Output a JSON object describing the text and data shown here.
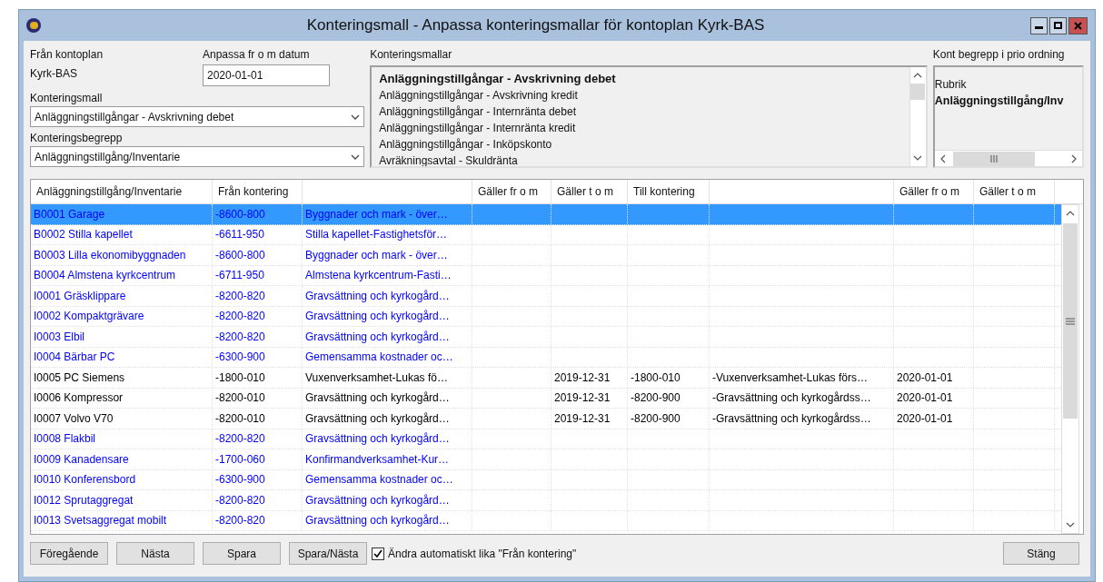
{
  "window": {
    "title": "Konteringsmall - Anpassa konteringsmallar för kontoplan Kyrk-BAS"
  },
  "source_plan": {
    "label": "Från kontoplan",
    "value": "Kyrk-BAS"
  },
  "date_field": {
    "label": "Anpassa fr o m datum",
    "value": "2020-01-01"
  },
  "template_select": {
    "label": "Konteringsmall",
    "value": "Anläggningstillgångar - Avskrivning debet"
  },
  "concept_select": {
    "label": "Konteringsbegrepp",
    "value": "Anläggningstillgång/Inventarie"
  },
  "templates": {
    "label": "Konteringsmallar",
    "items": [
      {
        "text": "Anläggningstillgångar - Avskrivning debet",
        "selected": true
      },
      {
        "text": "Anläggningstillgångar - Avskrivning kredit",
        "selected": false
      },
      {
        "text": "Anläggningstillgångar - Internränta debet",
        "selected": false
      },
      {
        "text": "Anläggningstillgångar - Internränta kredit",
        "selected": false
      },
      {
        "text": "Anläggningstillgångar - Inköpskonto",
        "selected": false
      },
      {
        "text": "Avräkningsavtal - Skuldränta",
        "selected": false
      }
    ]
  },
  "priority": {
    "label": "Kont begrepp i prio ordning",
    "items": [
      {
        "text": "Rubrik",
        "selected": false
      },
      {
        "text": "Anläggningstillgång/Inv",
        "selected": true
      }
    ]
  },
  "table": {
    "columns": [
      {
        "label": "Anläggningstillgång/Inventarie"
      },
      {
        "label": "Från kontering"
      },
      {},
      {
        "label": "Gäller fr o m"
      },
      {
        "label": "Gäller t o m"
      },
      {
        "label": "Till kontering"
      },
      {},
      {
        "label": "Gäller fr o m"
      },
      {
        "label": "Gäller t o m"
      }
    ],
    "rows": [
      {
        "selected": true,
        "color": "#0000ff",
        "asset": "B0001 Garage",
        "from_account": "-8600-800",
        "from_name": "Byggnader och mark - över…"
      },
      {
        "selected": false,
        "color": "#0000ff",
        "asset": "B0002 Stilla kapellet",
        "from_account": "-6611-950",
        "from_name": "Stilla kapellet-Fastighetsför…"
      },
      {
        "selected": false,
        "color": "#0000ff",
        "asset": "B0003 Lilla ekonomibyggnaden",
        "from_account": "-8600-800",
        "from_name": "Byggnader och mark - över…"
      },
      {
        "selected": false,
        "color": "#0000ff",
        "asset": "B0004 Almstena kyrkcentrum",
        "from_account": "-6711-950",
        "from_name": "Almstena kyrkcentrum-Fasti…"
      },
      {
        "selected": false,
        "color": "#0000ff",
        "asset": "I0001 Gräsklippare",
        "from_account": "-8200-820",
        "from_name": "Gravsättning och kyrkogård…"
      },
      {
        "selected": false,
        "color": "#0000ff",
        "asset": "I0002 Kompaktgrävare",
        "from_account": "-8200-820",
        "from_name": "Gravsättning och kyrkogård…"
      },
      {
        "selected": false,
        "color": "#0000ff",
        "asset": "I0003 Elbil",
        "from_account": "-8200-820",
        "from_name": "Gravsättning och kyrkogård…"
      },
      {
        "selected": false,
        "color": "#0000ff",
        "asset": "I0004 Bärbar PC",
        "from_account": "-6300-900",
        "from_name": "Gemensamma kostnader oc…"
      },
      {
        "selected": false,
        "color": "#000000",
        "asset": "I0005 PC Siemens",
        "from_account": "-1800-010",
        "from_name": "Vuxenverksamhet-Lukas fö…",
        "valid_to": "2019-12-31",
        "to_account": "-1800-010",
        "to_name": "-Vuxenverksamhet-Lukas förs…",
        "valid_from_2": "2020-01-01"
      },
      {
        "selected": false,
        "color": "#000000",
        "asset": "I0006 Kompressor",
        "from_account": "-8200-010",
        "from_name": "Gravsättning och kyrkogård…",
        "valid_to": "2019-12-31",
        "to_account": "-8200-900",
        "to_name": "-Gravsättning och kyrkogårdss…",
        "valid_from_2": "2020-01-01"
      },
      {
        "selected": false,
        "color": "#000000",
        "asset": "I0007 Volvo V70",
        "from_account": "-8200-010",
        "from_name": "Gravsättning och kyrkogård…",
        "valid_to": "2019-12-31",
        "to_account": "-8200-900",
        "to_name": "-Gravsättning och kyrkogårdss…",
        "valid_from_2": "2020-01-01"
      },
      {
        "selected": false,
        "color": "#0000ff",
        "asset": "I0008 Flakbil",
        "from_account": "-8200-820",
        "from_name": "Gravsättning och kyrkogård…"
      },
      {
        "selected": false,
        "color": "#0000ff",
        "asset": "I0009 Kanadensare",
        "from_account": "-1700-060",
        "from_name": "Konfirmandverksamhet-Kur…"
      },
      {
        "selected": false,
        "color": "#0000ff",
        "asset": "I0010 Konferensbord",
        "from_account": "-6300-900",
        "from_name": "Gemensamma kostnader oc…"
      },
      {
        "selected": false,
        "color": "#0000ff",
        "asset": "I0012 Sprutaggregat",
        "from_account": "-8200-820",
        "from_name": "Gravsättning och kyrkogård…"
      },
      {
        "selected": false,
        "color": "#0000ff",
        "asset": "I0013 Svetsaggregat mobilt",
        "from_account": "-8200-820",
        "from_name": "Gravsättning och kyrkogård…"
      }
    ]
  },
  "buttons": [
    "Föregående",
    "Nästa",
    "Spara",
    "Spara/Nästa"
  ],
  "auto_checkbox": {
    "label": "Ändra automatiskt lika \"Från kontering\"",
    "checked": true
  },
  "close_button": "Stäng"
}
